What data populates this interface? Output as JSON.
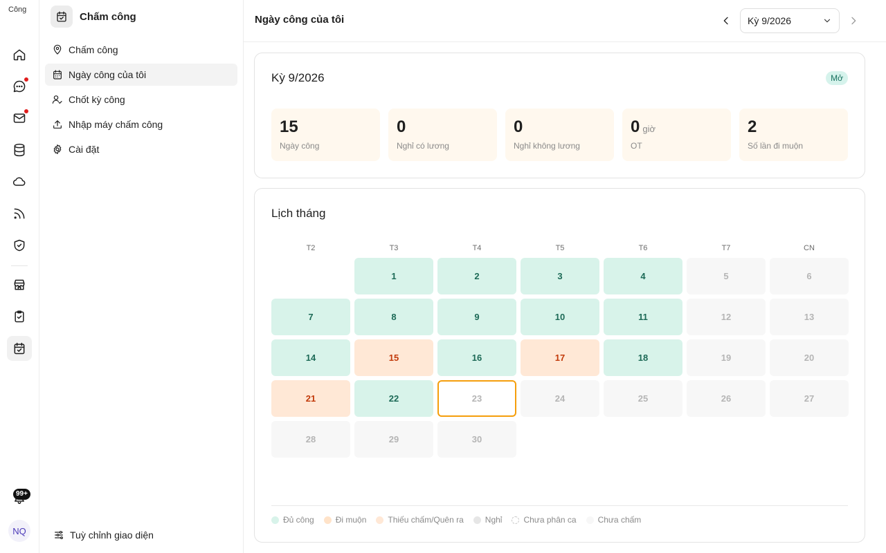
{
  "rail": {
    "logo_text": "Công",
    "notif_count": "99+",
    "avatar_initials": "NQ"
  },
  "sidebar": {
    "title": "Chấm công",
    "items": [
      {
        "label": "Chấm công",
        "icon": "location-pin-icon"
      },
      {
        "label": "Ngày công của tôi",
        "icon": "calendar-icon",
        "active": true
      },
      {
        "label": "Chốt kỳ công",
        "icon": "user-check-icon"
      },
      {
        "label": "Nhập máy chấm công",
        "icon": "upload-icon"
      },
      {
        "label": "Cài đặt",
        "icon": "gear-icon"
      }
    ],
    "customize_label": "Tuỳ chỉnh giao diện"
  },
  "header": {
    "title": "Ngày công của tôi",
    "period": "Kỳ 9/2026"
  },
  "summary": {
    "title": "Kỳ 9/2026",
    "status": "Mở",
    "stats": [
      {
        "value": "15",
        "unit": "",
        "label": "Ngày công"
      },
      {
        "value": "0",
        "unit": "",
        "label": "Nghỉ có lương"
      },
      {
        "value": "0",
        "unit": "",
        "label": "Nghỉ không lương"
      },
      {
        "value": "0",
        "unit": "giờ",
        "label": "OT"
      },
      {
        "value": "2",
        "unit": "",
        "label": "Số lần đi muộn"
      }
    ]
  },
  "calendar": {
    "title": "Lịch tháng",
    "weekdays": [
      "T2",
      "T3",
      "T4",
      "T5",
      "T6",
      "T7",
      "CN"
    ],
    "leading_blanks": 1,
    "days": [
      {
        "d": "1",
        "s": "full"
      },
      {
        "d": "2",
        "s": "full"
      },
      {
        "d": "3",
        "s": "full"
      },
      {
        "d": "4",
        "s": "full"
      },
      {
        "d": "5",
        "s": "none"
      },
      {
        "d": "6",
        "s": "none"
      },
      {
        "d": "7",
        "s": "full"
      },
      {
        "d": "8",
        "s": "full"
      },
      {
        "d": "9",
        "s": "full"
      },
      {
        "d": "10",
        "s": "full"
      },
      {
        "d": "11",
        "s": "full"
      },
      {
        "d": "12",
        "s": "none"
      },
      {
        "d": "13",
        "s": "none"
      },
      {
        "d": "14",
        "s": "full"
      },
      {
        "d": "15",
        "s": "late"
      },
      {
        "d": "16",
        "s": "full"
      },
      {
        "d": "17",
        "s": "late"
      },
      {
        "d": "18",
        "s": "full"
      },
      {
        "d": "19",
        "s": "none"
      },
      {
        "d": "20",
        "s": "none"
      },
      {
        "d": "21",
        "s": "late"
      },
      {
        "d": "22",
        "s": "full"
      },
      {
        "d": "23",
        "s": "today"
      },
      {
        "d": "24",
        "s": "none"
      },
      {
        "d": "25",
        "s": "none"
      },
      {
        "d": "26",
        "s": "none"
      },
      {
        "d": "27",
        "s": "none"
      },
      {
        "d": "28",
        "s": "none"
      },
      {
        "d": "29",
        "s": "none"
      },
      {
        "d": "30",
        "s": "none"
      }
    ],
    "legend": [
      {
        "label": "Đủ công",
        "color": "#d8f3ea"
      },
      {
        "label": "Đi muộn",
        "color": "#ffe3c9"
      },
      {
        "label": "Thiếu chấm/Quên ra",
        "color": "#ffe8d6"
      },
      {
        "label": "Nghỉ",
        "color": "#e6e6e6"
      },
      {
        "label": "Chưa phân ca",
        "color": "dashed"
      },
      {
        "label": "Chưa chấm",
        "color": "#f7f7f7"
      }
    ]
  }
}
